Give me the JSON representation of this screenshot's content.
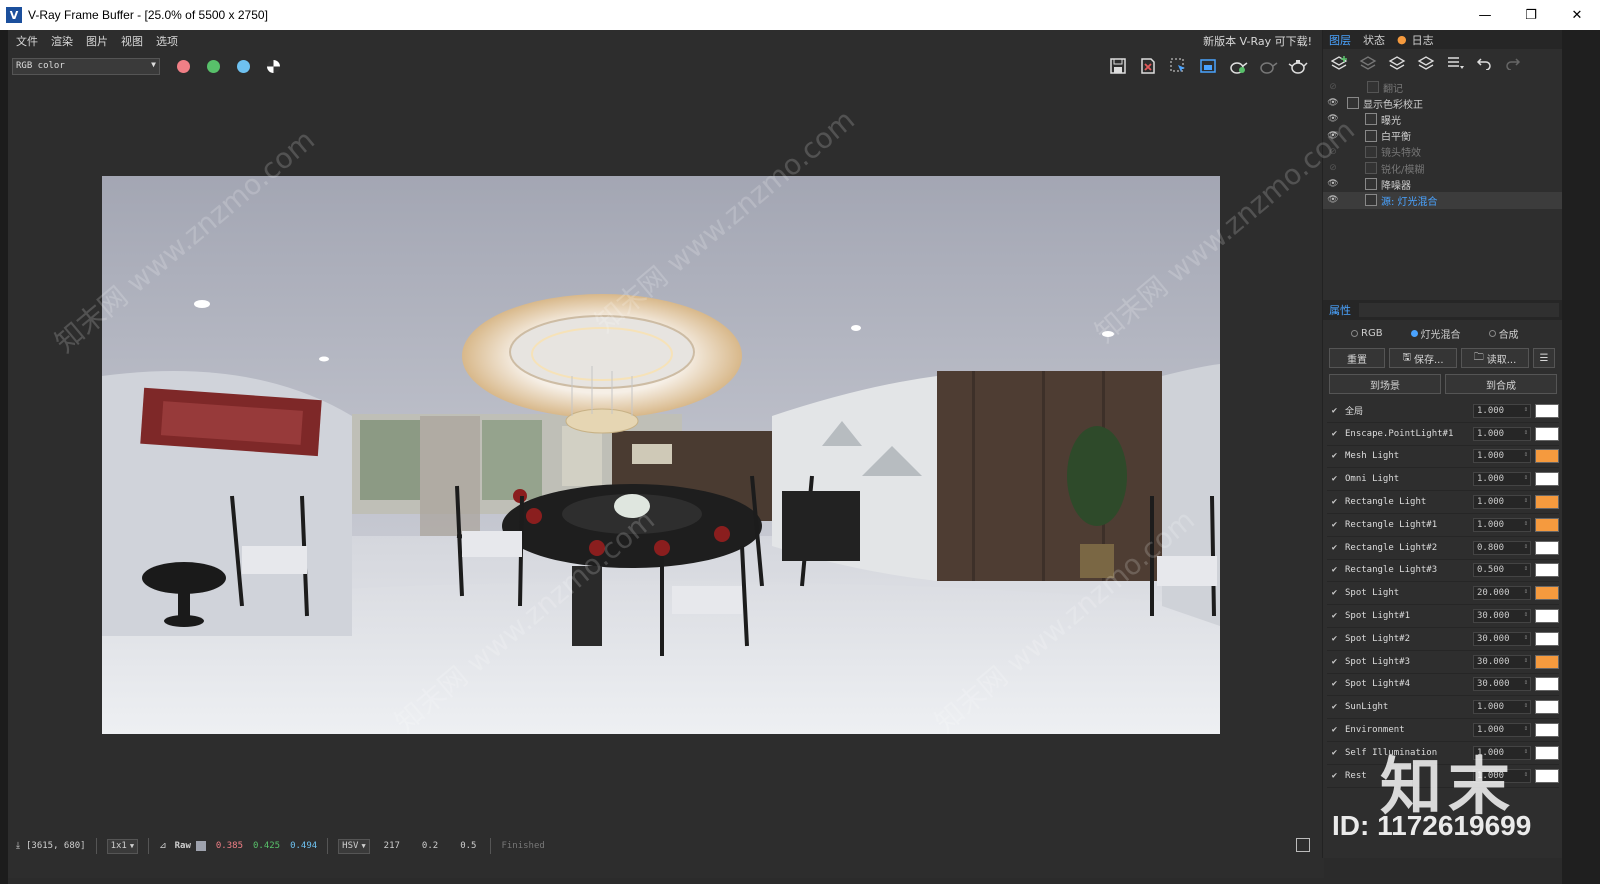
{
  "window": {
    "title": "V-Ray Frame Buffer - [25.0% of 5500 x 2750]",
    "minimize": "—",
    "maximize": "❐",
    "close": "✕"
  },
  "menu": [
    "文件",
    "渲染",
    "图片",
    "视图",
    "选项"
  ],
  "notice": "新版本 V-Ray 可下载!",
  "toolbar": {
    "channel": "RGB color",
    "dots": [
      "#f07f86",
      "#58c06a",
      "#6ec1f0"
    ]
  },
  "statusbar": {
    "coords": "[3615, 680]",
    "zoom": "1x1",
    "mode": "Raw",
    "r": "0.385",
    "g": "0.425",
    "b": "0.494",
    "colorspace": "HSV",
    "h": "217",
    "s": "0.2",
    "v": "0.5",
    "state": "Finished"
  },
  "panel": {
    "tabs": [
      "图层",
      "状态",
      "日志"
    ],
    "layers": [
      {
        "label": "翻记",
        "visible": false
      },
      {
        "label": "显示色彩校正",
        "visible": true
      },
      {
        "label": "曝光",
        "visible": true
      },
      {
        "label": "白平衡",
        "visible": true
      },
      {
        "label": "镜头特效",
        "visible": false
      },
      {
        "label": "锐化/模糊",
        "visible": false
      },
      {
        "label": "降噪器",
        "visible": true
      },
      {
        "label": "源: 灯光混合",
        "visible": true
      }
    ],
    "properties_label": "属性",
    "radios": [
      "RGB",
      "灯光混合",
      "合成"
    ],
    "reset": "重置",
    "save": "保存...",
    "load": "读取...",
    "to_scene": "到场景",
    "to_composite": "到合成",
    "lights": [
      {
        "name": "全局",
        "value": "1.000",
        "color": "#ffffff"
      },
      {
        "name": "Enscape.PointLight#1",
        "value": "1.000",
        "color": "#ffffff"
      },
      {
        "name": "Mesh Light",
        "value": "1.000",
        "color": "#f59a3e"
      },
      {
        "name": "Omni Light",
        "value": "1.000",
        "color": "#ffffff"
      },
      {
        "name": "Rectangle Light",
        "value": "1.000",
        "color": "#f59a3e"
      },
      {
        "name": "Rectangle Light#1",
        "value": "1.000",
        "color": "#f59a3e"
      },
      {
        "name": "Rectangle Light#2",
        "value": "0.800",
        "color": "#ffffff"
      },
      {
        "name": "Rectangle Light#3",
        "value": "0.500",
        "color": "#ffffff"
      },
      {
        "name": "Spot Light",
        "value": "20.000",
        "color": "#f59a3e"
      },
      {
        "name": "Spot Light#1",
        "value": "30.000",
        "color": "#ffffff"
      },
      {
        "name": "Spot Light#2",
        "value": "30.000",
        "color": "#ffffff"
      },
      {
        "name": "Spot Light#3",
        "value": "30.000",
        "color": "#f59a3e"
      },
      {
        "name": "Spot Light#4",
        "value": "30.000",
        "color": "#ffffff"
      },
      {
        "name": "SunLight",
        "value": "1.000",
        "color": "#ffffff"
      },
      {
        "name": "Environment",
        "value": "1.000",
        "color": "#ffffff"
      },
      {
        "name": "Self Illumination",
        "value": "1.000",
        "color": "#ffffff"
      },
      {
        "name": "Rest",
        "value": "1.000",
        "color": "#ffffff"
      }
    ]
  },
  "watermark": {
    "text": "知末网 www.znzmo.com",
    "brand": "知末",
    "id": "ID: 1172619699"
  }
}
